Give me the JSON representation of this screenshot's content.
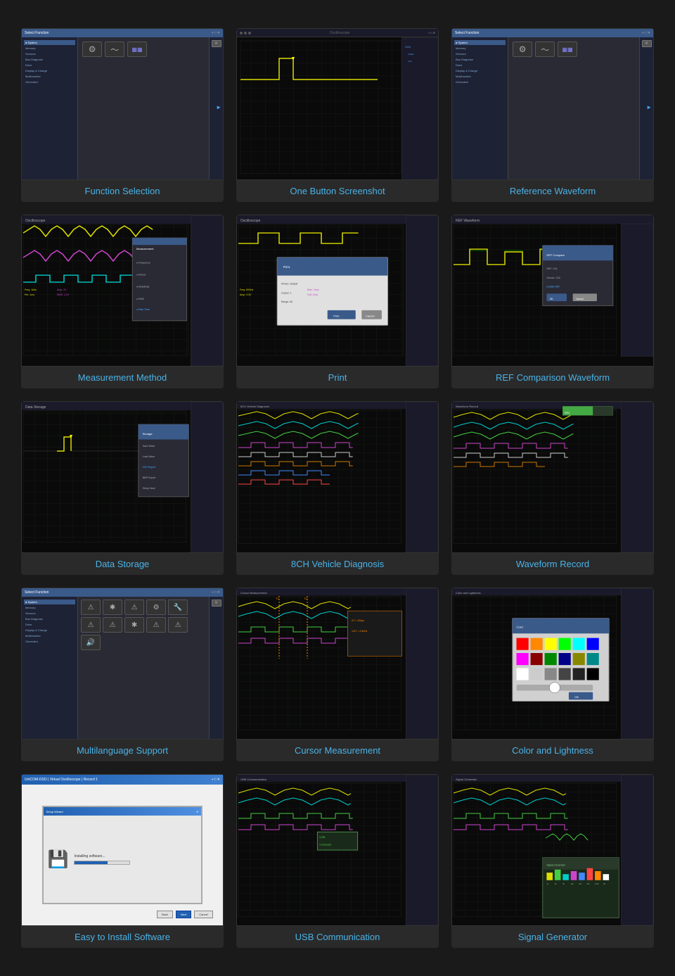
{
  "grid": {
    "items": [
      {
        "id": "function-selection",
        "label": "Function Selection",
        "type": "func-screen"
      },
      {
        "id": "one-button-screenshot",
        "label": "One Button Screenshot",
        "type": "screenshot"
      },
      {
        "id": "reference-waveform",
        "label": "Reference Waveform",
        "type": "func-screen-2"
      },
      {
        "id": "measurement-method",
        "label": "Measurement Method",
        "type": "multi-wave"
      },
      {
        "id": "print",
        "label": "Print",
        "type": "print"
      },
      {
        "id": "ref-comparison",
        "label": "REF Comparison Waveform",
        "type": "ref-comparison"
      },
      {
        "id": "data-storage",
        "label": "Data Storage",
        "type": "data-storage"
      },
      {
        "id": "8ch-vehicle",
        "label": "8CH Vehicle Diagnosis",
        "type": "multi-wave-2"
      },
      {
        "id": "waveform-record",
        "label": "Waveform Record",
        "type": "multi-wave-3"
      },
      {
        "id": "multilanguage",
        "label": "Multilanguage Support",
        "type": "multilanguage"
      },
      {
        "id": "cursor-measurement",
        "label": "Cursor Measurement",
        "type": "cursor-wave"
      },
      {
        "id": "color-lightness",
        "label": "Color and Lightness",
        "type": "color"
      },
      {
        "id": "easy-install",
        "label": "Easy to Install Software",
        "type": "install"
      },
      {
        "id": "usb-communication",
        "label": "USB Communication",
        "type": "usb-wave"
      },
      {
        "id": "signal-generator",
        "label": "Signal Generator",
        "type": "siggen"
      }
    ]
  }
}
